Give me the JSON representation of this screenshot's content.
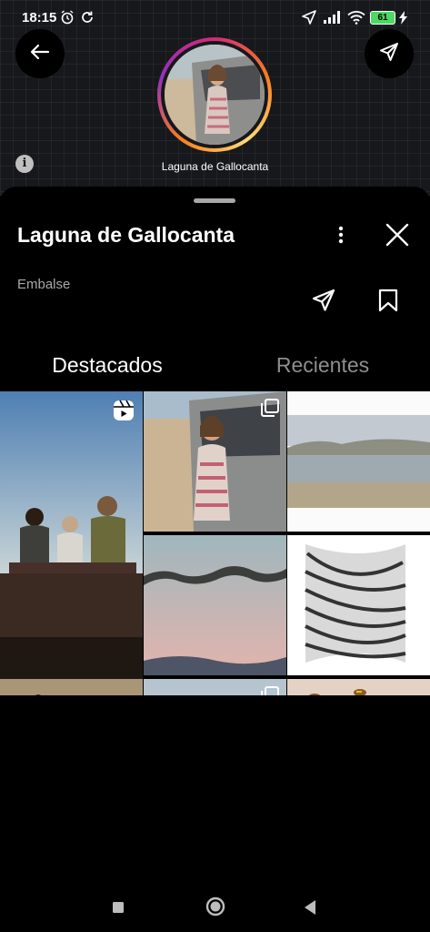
{
  "status": {
    "time": "18:15",
    "battery": "61"
  },
  "map": {
    "location_label": "Laguna de Gallocanta",
    "info_glyph": "i"
  },
  "header": {
    "back_icon": "arrow-left-icon",
    "share_icon": "send-icon"
  },
  "place": {
    "title": "Laguna de Gallocanta",
    "category": "Embalse"
  },
  "tabs": [
    {
      "label": "Destacados",
      "active": true
    },
    {
      "label": "Recientes",
      "active": false
    }
  ],
  "grid": {
    "items": [
      {
        "desc": "reel",
        "badge": "reel-icon"
      },
      {
        "desc": "multi",
        "badge": "carousel-icon"
      },
      {
        "desc": "single",
        "badge": ""
      },
      {
        "desc": "single",
        "badge": ""
      },
      {
        "desc": "single",
        "badge": ""
      },
      {
        "desc": "single",
        "badge": ""
      },
      {
        "desc": "multi",
        "badge": "carousel-icon"
      },
      {
        "desc": "single",
        "badge": ""
      },
      {
        "desc": "multi",
        "badge": "carousel-icon"
      },
      {
        "desc": "multi",
        "badge": "carousel-icon"
      },
      {
        "desc": "single",
        "badge": ""
      }
    ]
  },
  "colors": {
    "accent_ring_start": "#d62976",
    "accent_ring_mid": "#fa7e1e",
    "inactive_text": "#8e8e8e",
    "secondary_text": "#a8a8a8"
  }
}
